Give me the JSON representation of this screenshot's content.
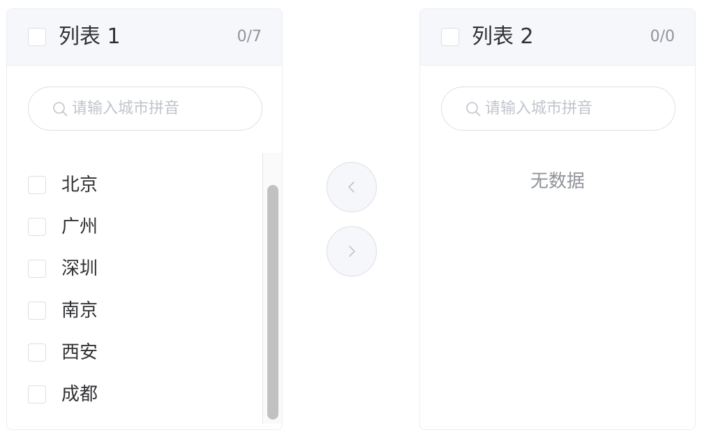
{
  "left_panel": {
    "title": "列表 1",
    "count": "0/7",
    "search_placeholder": "请输入城市拼音",
    "items": [
      {
        "label": "北京"
      },
      {
        "label": "广州"
      },
      {
        "label": "深圳"
      },
      {
        "label": "南京"
      },
      {
        "label": "西安"
      },
      {
        "label": "成都"
      }
    ]
  },
  "right_panel": {
    "title": "列表 2",
    "count": "0/0",
    "search_placeholder": "请输入城市拼音",
    "empty_text": "无数据"
  },
  "icons": {
    "search": "search-icon",
    "move_left": "chevron-left-icon",
    "move_right": "chevron-right-icon"
  },
  "colors": {
    "header_bg": "#f5f7fa",
    "border": "#ebeef5",
    "text_primary": "#303133",
    "text_secondary": "#909399",
    "placeholder": "#c0c4cc"
  }
}
